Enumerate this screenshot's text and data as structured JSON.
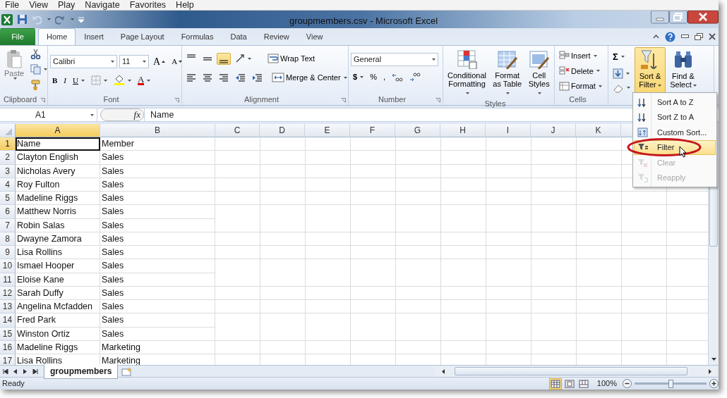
{
  "menu_bar": [
    "File",
    "View",
    "Play",
    "Navigate",
    "Favorites",
    "Help"
  ],
  "title_bar": {
    "title": "groupmembers.csv - Microsoft Excel"
  },
  "ribbon_tabs": [
    {
      "label": "File",
      "kind": "backstage",
      "selected": false
    },
    {
      "label": "Home",
      "kind": "tab",
      "selected": true
    },
    {
      "label": "Insert",
      "kind": "tab",
      "selected": false
    },
    {
      "label": "Page Layout",
      "kind": "tab",
      "selected": false
    },
    {
      "label": "Formulas",
      "kind": "tab",
      "selected": false
    },
    {
      "label": "Data",
      "kind": "tab",
      "selected": false
    },
    {
      "label": "Review",
      "kind": "tab",
      "selected": false
    },
    {
      "label": "View",
      "kind": "tab",
      "selected": false
    }
  ],
  "clipboard": {
    "paste": "Paste",
    "label": "Clipboard"
  },
  "font": {
    "name": "Calibri",
    "size": "11",
    "grow": "A",
    "shrink": "A",
    "bold": "B",
    "italic": "I",
    "underline": "U",
    "font_color_button": "A",
    "label": "Font"
  },
  "alignment": {
    "bottom_align_selected": true,
    "wrap_text": "Wrap Text",
    "merge": "Merge & Center",
    "label": "Alignment"
  },
  "number": {
    "format": "General",
    "currency": "$",
    "percent": "%",
    "comma": ",",
    "label": "Number"
  },
  "styles": {
    "buttons": [
      "Conditional Formatting",
      "Format as Table",
      "Cell Styles"
    ],
    "label": "Styles"
  },
  "cells": {
    "buttons": [
      "Insert",
      "Delete",
      "Format"
    ],
    "label": "Cells"
  },
  "editing": {
    "sum": "Σ",
    "buttons": [
      {
        "label": "Sort & Filter",
        "selected": true
      },
      {
        "label": "Find & Select",
        "selected": false
      }
    ]
  },
  "formula_bar": {
    "name_box": "A1",
    "function_label": "fx",
    "value": "Name"
  },
  "columns": [
    {
      "label": "A",
      "selected": true
    },
    {
      "label": "B",
      "selected": false
    },
    {
      "label": "C",
      "selected": false
    },
    {
      "label": "D",
      "selected": false
    },
    {
      "label": "E",
      "selected": false
    },
    {
      "label": "F",
      "selected": false
    },
    {
      "label": "G",
      "selected": false
    },
    {
      "label": "H",
      "selected": false
    },
    {
      "label": "I",
      "selected": false
    },
    {
      "label": "J",
      "selected": false
    },
    {
      "label": "K",
      "selected": false
    }
  ],
  "rows": [
    {
      "number": "1",
      "selected": true,
      "cells": [
        "Name",
        "Member"
      ]
    },
    {
      "number": "2",
      "selected": false,
      "cells": [
        "Clayton English",
        "Sales"
      ]
    },
    {
      "number": "3",
      "selected": false,
      "cells": [
        "Nicholas Avery",
        "Sales"
      ]
    },
    {
      "number": "4",
      "selected": false,
      "cells": [
        "Roy Fulton",
        "Sales"
      ]
    },
    {
      "number": "5",
      "selected": false,
      "cells": [
        "Madeline Riggs",
        "Sales"
      ]
    },
    {
      "number": "6",
      "selected": false,
      "cells": [
        "Matthew Norris",
        "Sales"
      ]
    },
    {
      "number": "7",
      "selected": false,
      "cells": [
        "Robin Salas",
        "Sales"
      ]
    },
    {
      "number": "8",
      "selected": false,
      "cells": [
        "Dwayne Zamora",
        "Sales"
      ]
    },
    {
      "number": "9",
      "selected": false,
      "cells": [
        "Lisa Rollins",
        "Sales"
      ]
    },
    {
      "number": "10",
      "selected": false,
      "cells": [
        "Ismael Hooper",
        "Sales"
      ]
    },
    {
      "number": "11",
      "selected": false,
      "cells": [
        "Eloise Kane",
        "Sales"
      ]
    },
    {
      "number": "12",
      "selected": false,
      "cells": [
        "Sarah Duffy",
        "Sales"
      ]
    },
    {
      "number": "13",
      "selected": false,
      "cells": [
        "Angelina Mcfadden",
        "Sales"
      ]
    },
    {
      "number": "14",
      "selected": false,
      "cells": [
        "Fred Park",
        "Sales"
      ]
    },
    {
      "number": "15",
      "selected": false,
      "cells": [
        "Winston Ortiz",
        "Sales"
      ]
    },
    {
      "number": "16",
      "selected": false,
      "cells": [
        "Madeline Riggs",
        "Marketing"
      ]
    },
    {
      "number": "17",
      "selected": false,
      "cells": [
        "Lisa Rollins",
        "Marketing"
      ]
    }
  ],
  "sheet_tabs": [
    {
      "label": "groupmembers",
      "selected": true
    }
  ],
  "status_bar": {
    "text": "Ready",
    "views": [
      {
        "kind": "normal",
        "selected": true
      },
      {
        "kind": "page_layout",
        "selected": false
      },
      {
        "kind": "page_break",
        "selected": false
      }
    ],
    "zoom": "100%",
    "zoom_slider": {
      "level": 0.5
    }
  },
  "dropdown_menu": {
    "items": [
      {
        "label": "Sort A to Z",
        "kind": "sort_asc",
        "disabled": false,
        "selected": false,
        "circled": false
      },
      {
        "label": "Sort Z to A",
        "kind": "sort_desc",
        "disabled": false,
        "selected": false,
        "circled": false
      },
      {
        "label": "Custom Sort...",
        "kind": "custom_sort",
        "disabled": false,
        "selected": false,
        "circled": false
      },
      {
        "label": "Filter",
        "kind": "filter",
        "disabled": false,
        "selected": true,
        "circled": true
      },
      {
        "label": "Clear",
        "kind": "clear",
        "disabled": true,
        "selected": false,
        "circled": false
      },
      {
        "label": "Reapply",
        "kind": "reapply",
        "disabled": true,
        "selected": false,
        "circled": false
      }
    ]
  }
}
